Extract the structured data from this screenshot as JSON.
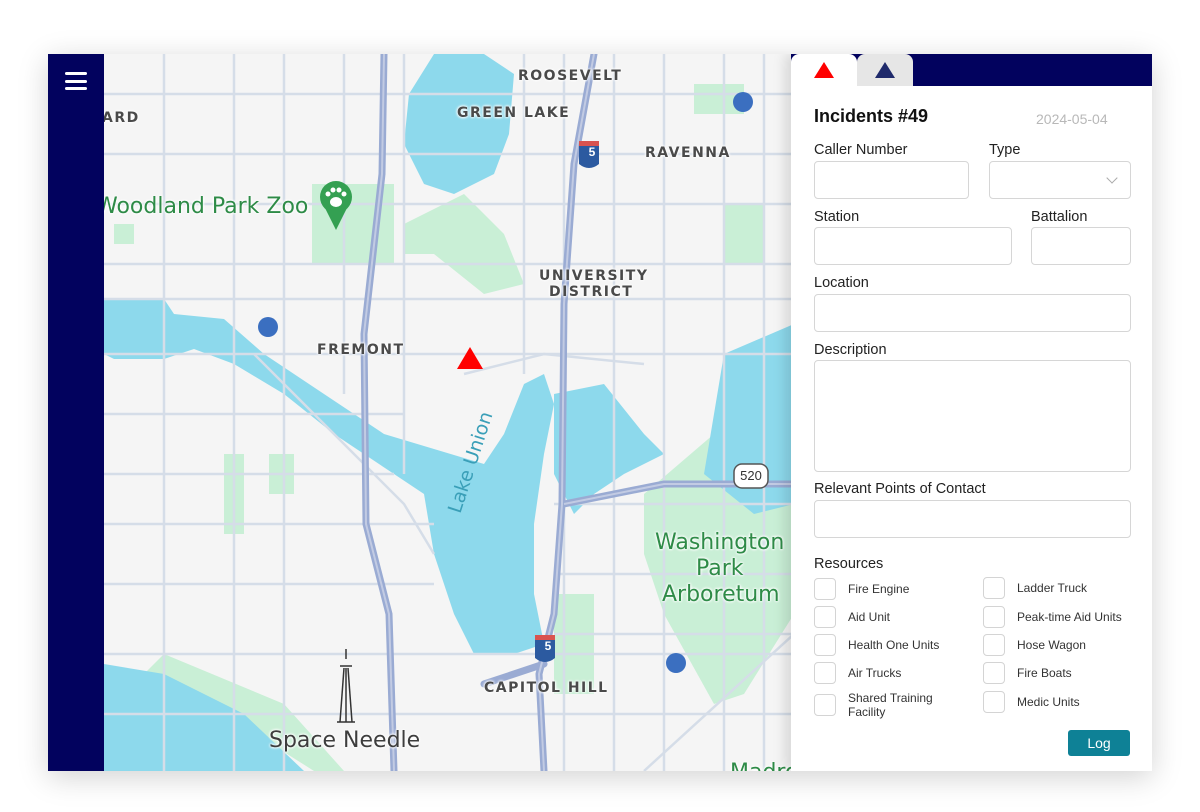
{
  "sidebar": {
    "menu_icon": "hamburger-menu-icon"
  },
  "map": {
    "labels": {
      "ard": "ARD",
      "roosevelt": "ROOSEVELT",
      "green_lake": "GREEN LAKE",
      "ravenna": "RAVENNA",
      "woodland_park_zoo": "Woodland Park Zoo",
      "university": "UNIVERSITY",
      "district": "DISTRICT",
      "fremont": "FREMONT",
      "lake_union": "Lake Union",
      "washington": "Washington",
      "park": "Park",
      "arboretum": "Arboretum",
      "capitol_hill": "CAPITOL HILL",
      "space_needle": "Space Needle",
      "madrona": "Madro",
      "i5_shield": "5",
      "sr520_shield": "520"
    },
    "markers": {
      "incident_color": "#ff0000",
      "unit_color": "#3b6fc0"
    }
  },
  "panel": {
    "tabs": [
      {
        "icon": "red-triangle-icon",
        "active": true
      },
      {
        "icon": "navy-triangle-icon",
        "active": false
      }
    ],
    "title": "Incidents #49",
    "date": "2024-05-04",
    "fields": {
      "caller_number": {
        "label": "Caller Number",
        "value": ""
      },
      "type": {
        "label": "Type",
        "value": ""
      },
      "station": {
        "label": "Station",
        "value": ""
      },
      "battalion": {
        "label": "Battalion",
        "value": ""
      },
      "location": {
        "label": "Location",
        "value": ""
      },
      "description": {
        "label": "Description",
        "value": ""
      },
      "points_of_contact": {
        "label": "Relevant Points of Contact",
        "value": ""
      }
    },
    "resources": {
      "heading": "Resources",
      "items": [
        {
          "label": "Fire Engine",
          "checked": false
        },
        {
          "label": "Ladder Truck",
          "checked": false
        },
        {
          "label": "Aid Unit",
          "checked": false
        },
        {
          "label": "Peak-time Aid Units",
          "checked": false
        },
        {
          "label": "Health One Units",
          "checked": false
        },
        {
          "label": "Hose Wagon",
          "checked": false
        },
        {
          "label": "Air Trucks",
          "checked": false
        },
        {
          "label": "Fire Boats",
          "checked": false
        },
        {
          "label": "Shared Training Facility",
          "checked": false
        },
        {
          "label": "Medic Units",
          "checked": false
        }
      ]
    },
    "log_button": "Log",
    "colors": {
      "navy": "#02025e",
      "accent": "#0e8196"
    }
  }
}
